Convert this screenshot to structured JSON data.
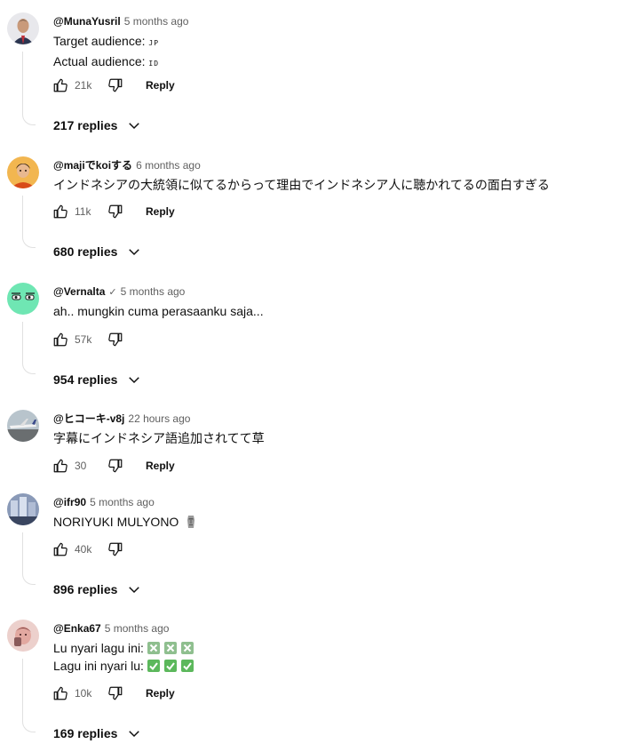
{
  "comments": [
    {
      "author": "@MunaYusril",
      "time": "5 months ago",
      "lines": [
        {
          "text": "Target audience:",
          "tag": "JP"
        },
        {
          "text": "Actual audience:",
          "tag": "ID"
        }
      ],
      "likes": "21k",
      "reply_label": "Reply",
      "replies_label": "217 replies",
      "avatar": {
        "bg": "#3b4a66",
        "fg": "#d8b59a"
      }
    },
    {
      "author": "@majiでkoiする",
      "time": "6 months ago",
      "text": "インドネシアの大統領に似てるからって理由でインドネシア人に聴かれてるの面白すぎる",
      "likes": "11k",
      "reply_label": "Reply",
      "replies_label": "680 replies",
      "avatar": {
        "bg": "#e8a040",
        "fg": "#d85a20"
      }
    },
    {
      "author": "@Vernalta",
      "time": "5 months ago",
      "verified_icon": "✓",
      "text": "ah.. mungkin cuma perasaanku saja...",
      "likes": "57k",
      "replies_label": "954 replies",
      "avatar": {
        "bg": "#6ee8b4",
        "fg": "#1a3a2a"
      }
    },
    {
      "author": "@ヒコーキ-v8j",
      "time": "22 hours ago",
      "text": "字幕にインドネシア語追加されてて草",
      "likes": "30",
      "reply_label": "Reply",
      "avatar": {
        "bg": "#9aa6b0",
        "fg": "#e6e6e6"
      }
    },
    {
      "author": "@ifr90",
      "time": "5 months ago",
      "text": "NORIYUKI MULYONO",
      "emoji": "moai-icon",
      "likes": "40k",
      "replies_label": "896 replies",
      "avatar": {
        "bg": "#5a6a8a",
        "fg": "#c8d0e0"
      }
    },
    {
      "author": "@Enka67",
      "time": "5 months ago",
      "lines": [
        {
          "text": "Lu nyari lagu ini:",
          "emoji": "cross-mark-button"
        },
        {
          "text": "Lagu ini nyari lu:",
          "emoji": "check-mark-button"
        }
      ],
      "likes": "10k",
      "reply_label": "Reply",
      "replies_label": "169 replies",
      "avatar": {
        "bg": "#e6c2bd",
        "fg": "#8a4a4a"
      }
    }
  ]
}
